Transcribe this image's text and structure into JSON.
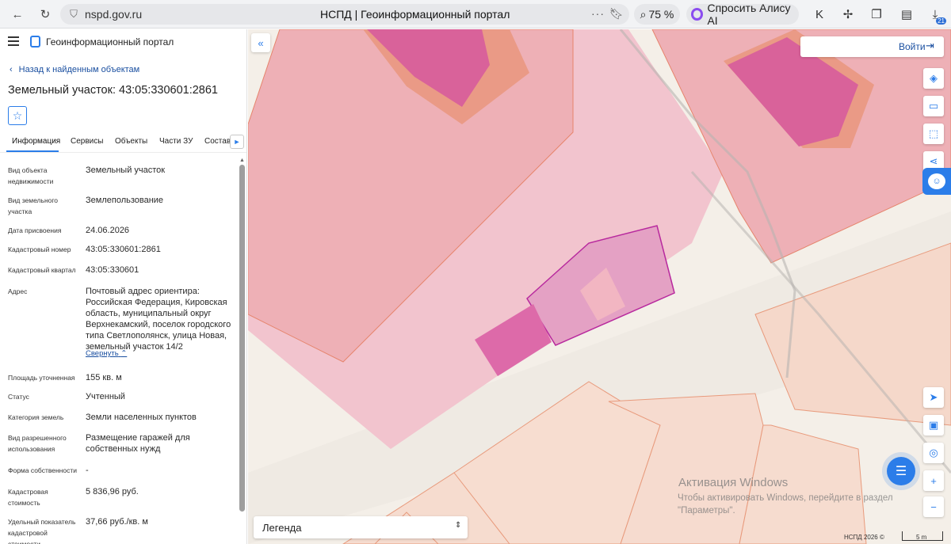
{
  "browser": {
    "url": "nspd.gov.ru",
    "page_title": "НСПД | Геоинформационный портал",
    "zoom": "75 %",
    "alice_label": "Спросить Алису AI",
    "badge_count": "21"
  },
  "sidebar": {
    "portal_name": "Геоинформационный портал",
    "back_label": "Назад к найденным объектам",
    "title": "Земельный участок: 43:05:330601:2861",
    "tabs": [
      "Информация",
      "Сервисы",
      "Объекты",
      "Части ЗУ",
      "Состав"
    ],
    "props": [
      {
        "label": "Вид объекта недвижимости",
        "value": "Земельный участок"
      },
      {
        "label": "Вид земельного участка",
        "value": "Землепользование"
      },
      {
        "label": "Дата присвоения",
        "value": "24.06.2026"
      },
      {
        "label": "Кадастровый номер",
        "value": "43:05:330601:2861"
      },
      {
        "label": "Кадастровый квартал",
        "value": "43:05:330601"
      },
      {
        "label": "Адрес",
        "value": "Почтовый адрес ориентира: Российская Федерация, Кировская область, муниципальный округ Верхнекамский, поселок городского типа Светлополянск, улица Новая, земельный участок 14/2"
      },
      {
        "label": "Площадь уточненная",
        "value": "155 кв. м"
      },
      {
        "label": "Статус",
        "value": "Учтенный"
      },
      {
        "label": "Категория земель",
        "value": "Земли населенных пунктов"
      },
      {
        "label": "Вид разрешенного использования",
        "value": "Размещение гаражей для собственных нужд"
      },
      {
        "label": "Форма собственности",
        "value": "-"
      },
      {
        "label": "Кадастровая стоимость",
        "value": "5 836,96 руб."
      },
      {
        "label": "Удельный показатель кадастровой стоимости",
        "value": "37,66 руб./кв. м"
      }
    ],
    "collapse_label": "Свернуть"
  },
  "map": {
    "login_label": "Войти",
    "legend_label": "Легенда",
    "watermark_title": "Активация Windows",
    "watermark_text": "Чтобы активировать Windows, перейдите в раздел \"Параметры\".",
    "copyright": "НСПД 2026 ©",
    "scale": "5 m"
  }
}
